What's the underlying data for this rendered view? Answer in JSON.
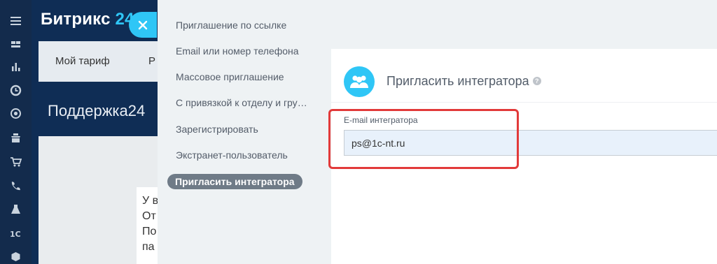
{
  "app": {
    "brand_name": "Битрикс",
    "brand_suffix": "24",
    "topbar": [
      "Мой тариф",
      "Р"
    ],
    "page_heading": "Поддержка24",
    "content_lines": [
      "У в",
      "От",
      "По",
      "па"
    ]
  },
  "slider": {
    "menu": [
      "Приглашение по ссылке",
      "Email или номер телефона",
      "Массовое приглашение",
      "С привязкой к отделу и группам",
      "Зарегистрировать",
      "Экстранет-пользователь"
    ],
    "active_item": "Пригласить интегратора",
    "card": {
      "title": "Пригласить интегратора",
      "help": "?",
      "field_label": "E-mail интегратора",
      "field_value": "ps@1c-nt.ru"
    }
  },
  "colors": {
    "accent": "#2fc6f6",
    "highlight": "#e23a3a",
    "active_menu": "#6f7b87"
  },
  "icons": {
    "close": "close-icon",
    "avatar": "users-group-icon"
  }
}
